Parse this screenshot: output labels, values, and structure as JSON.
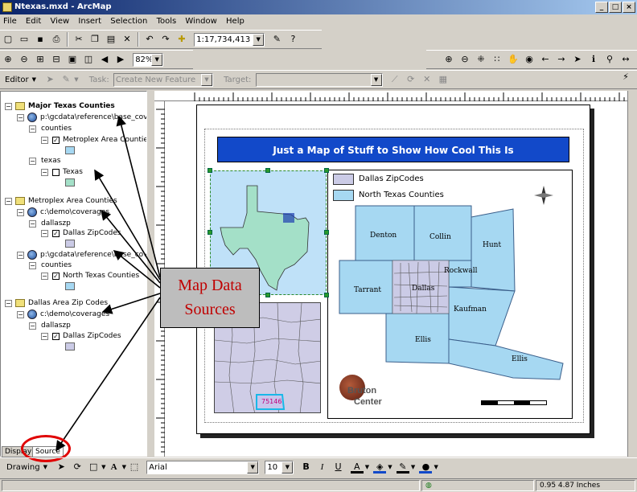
{
  "window": {
    "title": "Ntexas.mxd - ArcMap",
    "min": "_",
    "max": "□",
    "close": "×"
  },
  "menu": [
    "File",
    "Edit",
    "View",
    "Insert",
    "Selection",
    "Tools",
    "Window",
    "Help"
  ],
  "toolbar1": {
    "scale": "1:17,734,413"
  },
  "toolbar2": {
    "zoom": "82%"
  },
  "toolbar3": {
    "editor": "Editor",
    "task_label": "Task:",
    "task_value": "Create New Feature",
    "target_label": "Target:",
    "target_value": ""
  },
  "toc": {
    "df1": {
      "name": "Major Texas Counties",
      "path1": "p:\\gcdata\\reference\\base_covers",
      "layer1": "counties",
      "sub1": "Metroplex Area Counties",
      "layer2": "texas",
      "sub2": "Texas"
    },
    "df2": {
      "name": "Metroplex Area Counties",
      "path1": "c:\\demo\\coverages",
      "layer1": "dallaszp",
      "sub1": "Dallas ZipCodes",
      "path2": "p:\\gcdata\\reference\\base_covers",
      "layer2": "counties",
      "sub2": "North Texas Counties"
    },
    "df3": {
      "name": "Dallas Area Zip Codes",
      "path1": "c:\\demo\\coverages",
      "layer1": "dallaszp",
      "sub1": "Dallas ZipCodes"
    },
    "tab_display": "Display",
    "tab_source": "Source"
  },
  "map": {
    "title": "Just a Map of Stuff to Show How Cool This Is",
    "legend": [
      {
        "label": "Dallas ZipCodes",
        "color": "#cbcbe6"
      },
      {
        "label": "North Texas Counties",
        "color": "#a6d8f2"
      }
    ],
    "counties": [
      "Denton",
      "Collin",
      "Hunt",
      "Rockwall",
      "Tarrant",
      "Dallas",
      "Kaufman",
      "Ellis",
      "Ellis"
    ],
    "zip": "75146",
    "logo_line1": "Bruton",
    "logo_line2": "Center",
    "colors": {
      "title_bg": "#1249c9",
      "county_fill": "#a6d8f2",
      "zip_fill": "#cbcbe6",
      "texas_fill": "#a4e0c8"
    }
  },
  "callout": {
    "line1": "Map Data",
    "line2": "Sources"
  },
  "drawing": {
    "label": "Drawing",
    "font": "Arial",
    "size": "10",
    "bold": "B",
    "italic": "I",
    "underline": "U"
  },
  "status": {
    "coords": "0.95  4.87 Inches"
  }
}
